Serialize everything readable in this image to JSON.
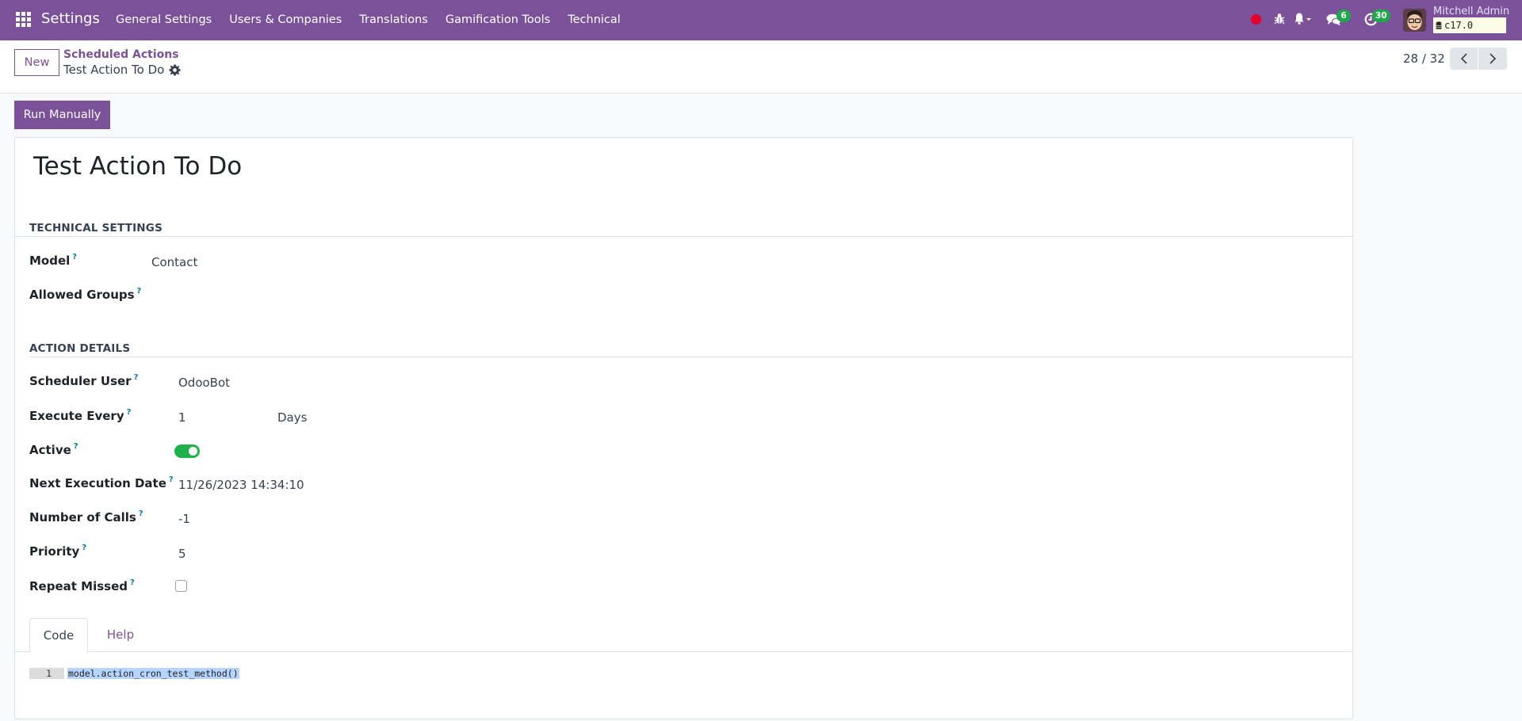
{
  "navbar": {
    "app_name": "Settings",
    "menu": [
      "General Settings",
      "Users & Companies",
      "Translations",
      "Gamification Tools",
      "Technical"
    ],
    "messages_count": "6",
    "activities_count": "30",
    "user_name": "Mitchell Admin",
    "database": "c17.0",
    "colors": {
      "brand": "#7b5299",
      "badge": "#1fa74a",
      "record_dot": "#e8002d"
    }
  },
  "control_panel": {
    "new_label": "New",
    "breadcrumb_parent": "Scheduled Actions",
    "breadcrumb_current": "Test Action To Do",
    "pager": "28 / 32"
  },
  "status_bar": {
    "run_label": "Run Manually"
  },
  "form": {
    "title": "Test Action To Do",
    "technical_settings": {
      "heading": "TECHNICAL SETTINGS",
      "model_label": "Model",
      "model_value": "Contact",
      "groups_label": "Allowed Groups",
      "groups_value": ""
    },
    "action_details": {
      "heading": "ACTION DETAILS",
      "user_label": "Scheduler User",
      "user_value": "OdooBot",
      "interval_label": "Execute Every",
      "interval_number": "1",
      "interval_type": "Days",
      "active_label": "Active",
      "active": true,
      "nextcall_label": "Next Execution Date",
      "nextcall_value": "11/26/2023 14:34:10",
      "numbercall_label": "Number of Calls",
      "numbercall_value": "-1",
      "priority_label": "Priority",
      "priority_value": "5",
      "doall_label": "Repeat Missed",
      "doall": false
    },
    "tooltip_mark": "?",
    "tabs": [
      "Code",
      "Help"
    ],
    "code": {
      "line_number": "1",
      "line": "model.action_cron_test_method()"
    }
  }
}
